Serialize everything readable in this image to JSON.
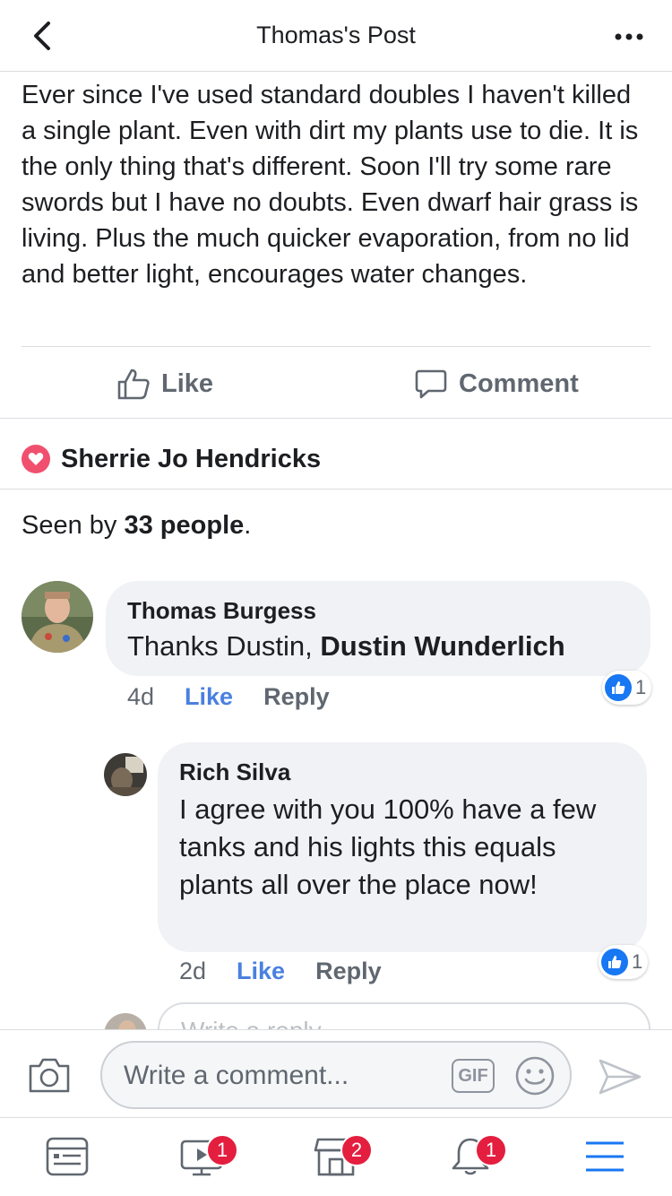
{
  "header": {
    "title": "Thomas's Post"
  },
  "post": {
    "text": "Ever since I've used standard doubles I haven't killed a single plant.  Even with dirt my plants use to die.  It is the only thing that's different.  Soon I'll try some rare swords but I have no doubts.  Even dwarf hair grass is living.  Plus the much quicker evaporation, from no lid and better light, encourages water changes.",
    "actions": {
      "like_label": "Like",
      "comment_label": "Comment"
    }
  },
  "reactions": {
    "reactor_name": "Sherrie Jo Hendricks"
  },
  "seen_by": {
    "prefix": "Seen by ",
    "count_text": "33 people",
    "suffix": "."
  },
  "comments": [
    {
      "author": "Thomas Burgess",
      "text_plain": "Thanks Dustin, ",
      "text_tag": "Dustin Wunderlich",
      "time": "4d",
      "like_label": "Like",
      "reply_label": "Reply",
      "reaction_count": "1"
    },
    {
      "author": "Rich Silva",
      "text": "I agree with you 100% have a few tanks and his lights this equals plants all over the place now!",
      "time": "2d",
      "like_label": "Like",
      "reply_label": "Reply",
      "reaction_count": "1"
    }
  ],
  "reply_box": {
    "placeholder": "Write a reply..."
  },
  "composer": {
    "placeholder": "Write a comment...",
    "gif_label": "GIF"
  },
  "tabbar": {
    "items": [
      {
        "icon": "news-feed-icon",
        "badge": ""
      },
      {
        "icon": "watch-video-icon",
        "badge": "1"
      },
      {
        "icon": "marketplace-icon",
        "badge": "2"
      },
      {
        "icon": "notifications-bell-icon",
        "badge": "1"
      },
      {
        "icon": "menu-icon",
        "badge": ""
      }
    ]
  },
  "colors": {
    "accent_blue": "#1877f2",
    "link_blue": "#4a80e0",
    "heart_red": "#f0506e",
    "badge_red": "#e41e3f",
    "bubble_grey": "#f0f2f5"
  }
}
